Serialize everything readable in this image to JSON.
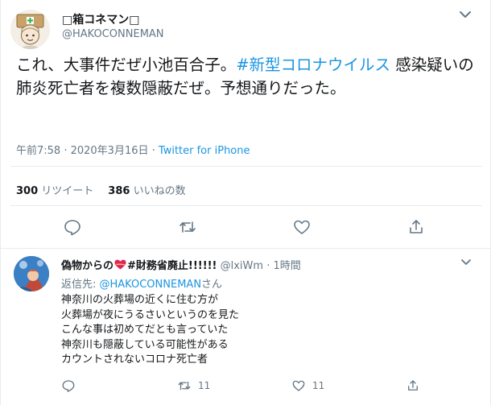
{
  "colors": {
    "link": "#1b95e0",
    "secondary": "#657786",
    "text": "#14171a",
    "border": "#e6ecf0",
    "heart": "#e0245e"
  },
  "tweet": {
    "display_name": "□箱コネマン□",
    "handle": "@HAKOCONNEMAN",
    "text_part1": "これ、大事件だぜ小池百合子。",
    "hashtag": "#新型コロナウイルス",
    "text_part2": " 感染疑いの肺炎死亡者を複数隠蔽だぜ。予想通りだった。",
    "time": "午前7:58 · 2020年3月16日",
    "separator": " · ",
    "source": "Twitter for iPhone",
    "retweet_count": "300",
    "retweet_label": "リツイート",
    "like_count": "386",
    "like_label": "いいねの数",
    "action_icons": [
      "reply-icon",
      "retweet-icon",
      "like-icon",
      "share-icon"
    ]
  },
  "reply": {
    "display_name": "偽物からの",
    "display_name_suffix": "#財務省廃止!!!!!!",
    "heart_emoji_icon": "heart-emoji-icon",
    "handle": "@lxiWm",
    "dot": "·",
    "time": "1時間",
    "reply_to_label": "返信先: ",
    "reply_to_mention": "@HAKOCONNEMAN",
    "reply_to_suffix": "さん",
    "lines": [
      "神奈川の火葬場の近くに住む方が",
      "火葬場が夜にうるさいというのを見た",
      "こんな事は初めてだとも言っていた",
      "神奈川も隠蔽している可能性がある",
      "カウントされないコロナ死亡者"
    ],
    "reply_count": "",
    "retweet_count": "11",
    "like_count": "11"
  }
}
